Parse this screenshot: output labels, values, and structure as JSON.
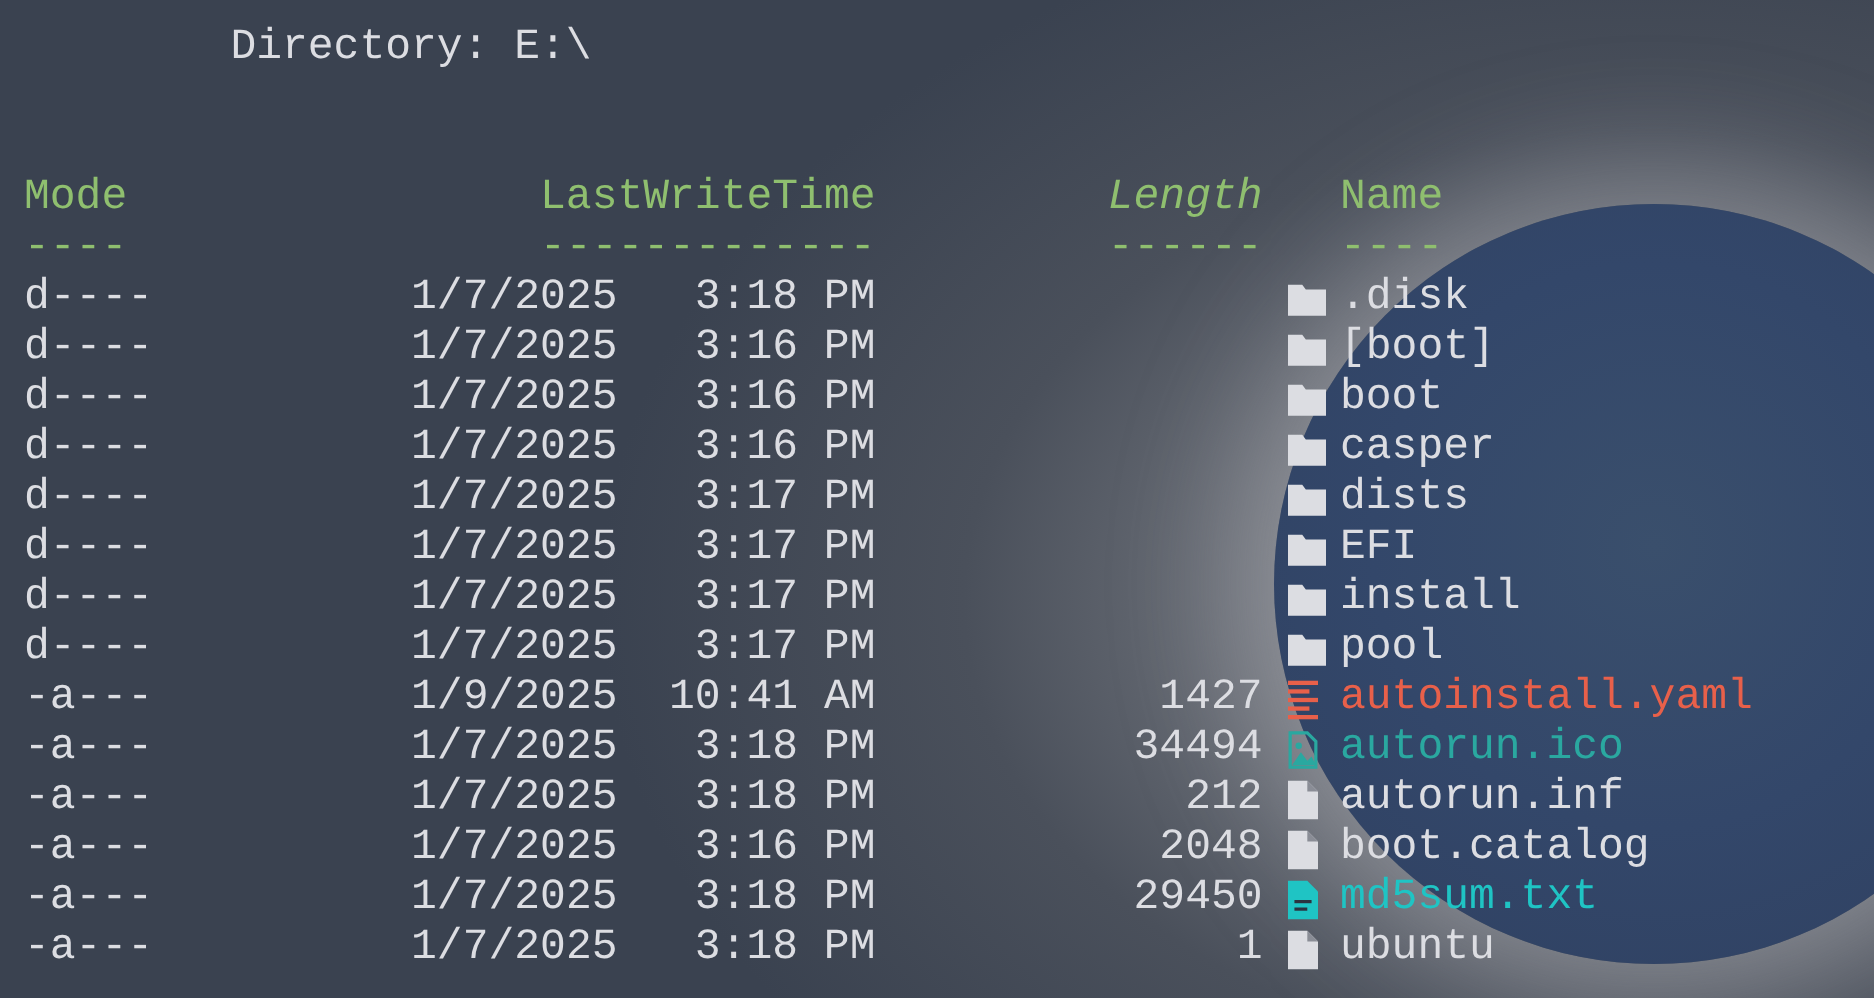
{
  "directory": "Directory: E:\\",
  "columns": [
    {
      "label": "Mode",
      "underline": "----",
      "italic": false
    },
    {
      "label": "LastWriteTime",
      "underline": "-------------",
      "italic": false
    },
    {
      "label": "Length",
      "underline": "------",
      "italic": true
    },
    {
      "label": "Name",
      "underline": "----",
      "italic": false
    }
  ],
  "rows": [
    {
      "mode": "d----",
      "date": "1/7/2025",
      "time": "3:18 PM",
      "name": ".disk",
      "kind": "folder"
    },
    {
      "mode": "d----",
      "date": "1/7/2025",
      "time": "3:16 PM",
      "name": "[boot]",
      "kind": "folder"
    },
    {
      "mode": "d----",
      "date": "1/7/2025",
      "time": "3:16 PM",
      "name": "boot",
      "kind": "folder"
    },
    {
      "mode": "d----",
      "date": "1/7/2025",
      "time": "3:16 PM",
      "name": "casper",
      "kind": "folder"
    },
    {
      "mode": "d----",
      "date": "1/7/2025",
      "time": "3:17 PM",
      "name": "dists",
      "kind": "folder"
    },
    {
      "mode": "d----",
      "date": "1/7/2025",
      "time": "3:17 PM",
      "name": "EFI",
      "kind": "folder"
    },
    {
      "mode": "d----",
      "date": "1/7/2025",
      "time": "3:17 PM",
      "name": "install",
      "kind": "folder"
    },
    {
      "mode": "d----",
      "date": "1/7/2025",
      "time": "3:17 PM",
      "name": "pool",
      "kind": "folder"
    },
    {
      "mode": "-a---",
      "date": "1/9/2025",
      "time": "10:41 AM",
      "length": "1427",
      "name": "autoinstall.yaml",
      "kind": "config",
      "color": "#e8604a"
    },
    {
      "mode": "-a---",
      "date": "1/7/2025",
      "time": "3:18 PM",
      "length": "34494",
      "name": "autorun.ico",
      "kind": "image",
      "color": "#2aa8a0"
    },
    {
      "mode": "-a---",
      "date": "1/7/2025",
      "time": "3:18 PM",
      "length": "212",
      "name": "autorun.inf",
      "kind": "file"
    },
    {
      "mode": "-a---",
      "date": "1/7/2025",
      "time": "3:16 PM",
      "length": "2048",
      "name": "boot.catalog",
      "kind": "file"
    },
    {
      "mode": "-a---",
      "date": "1/7/2025",
      "time": "3:18 PM",
      "length": "29450",
      "name": "md5sum.txt",
      "kind": "text",
      "color": "#1fc4c4"
    },
    {
      "mode": "-a---",
      "date": "1/7/2025",
      "time": "3:18 PM",
      "length": "1",
      "name": "ubuntu",
      "kind": "file"
    }
  ]
}
